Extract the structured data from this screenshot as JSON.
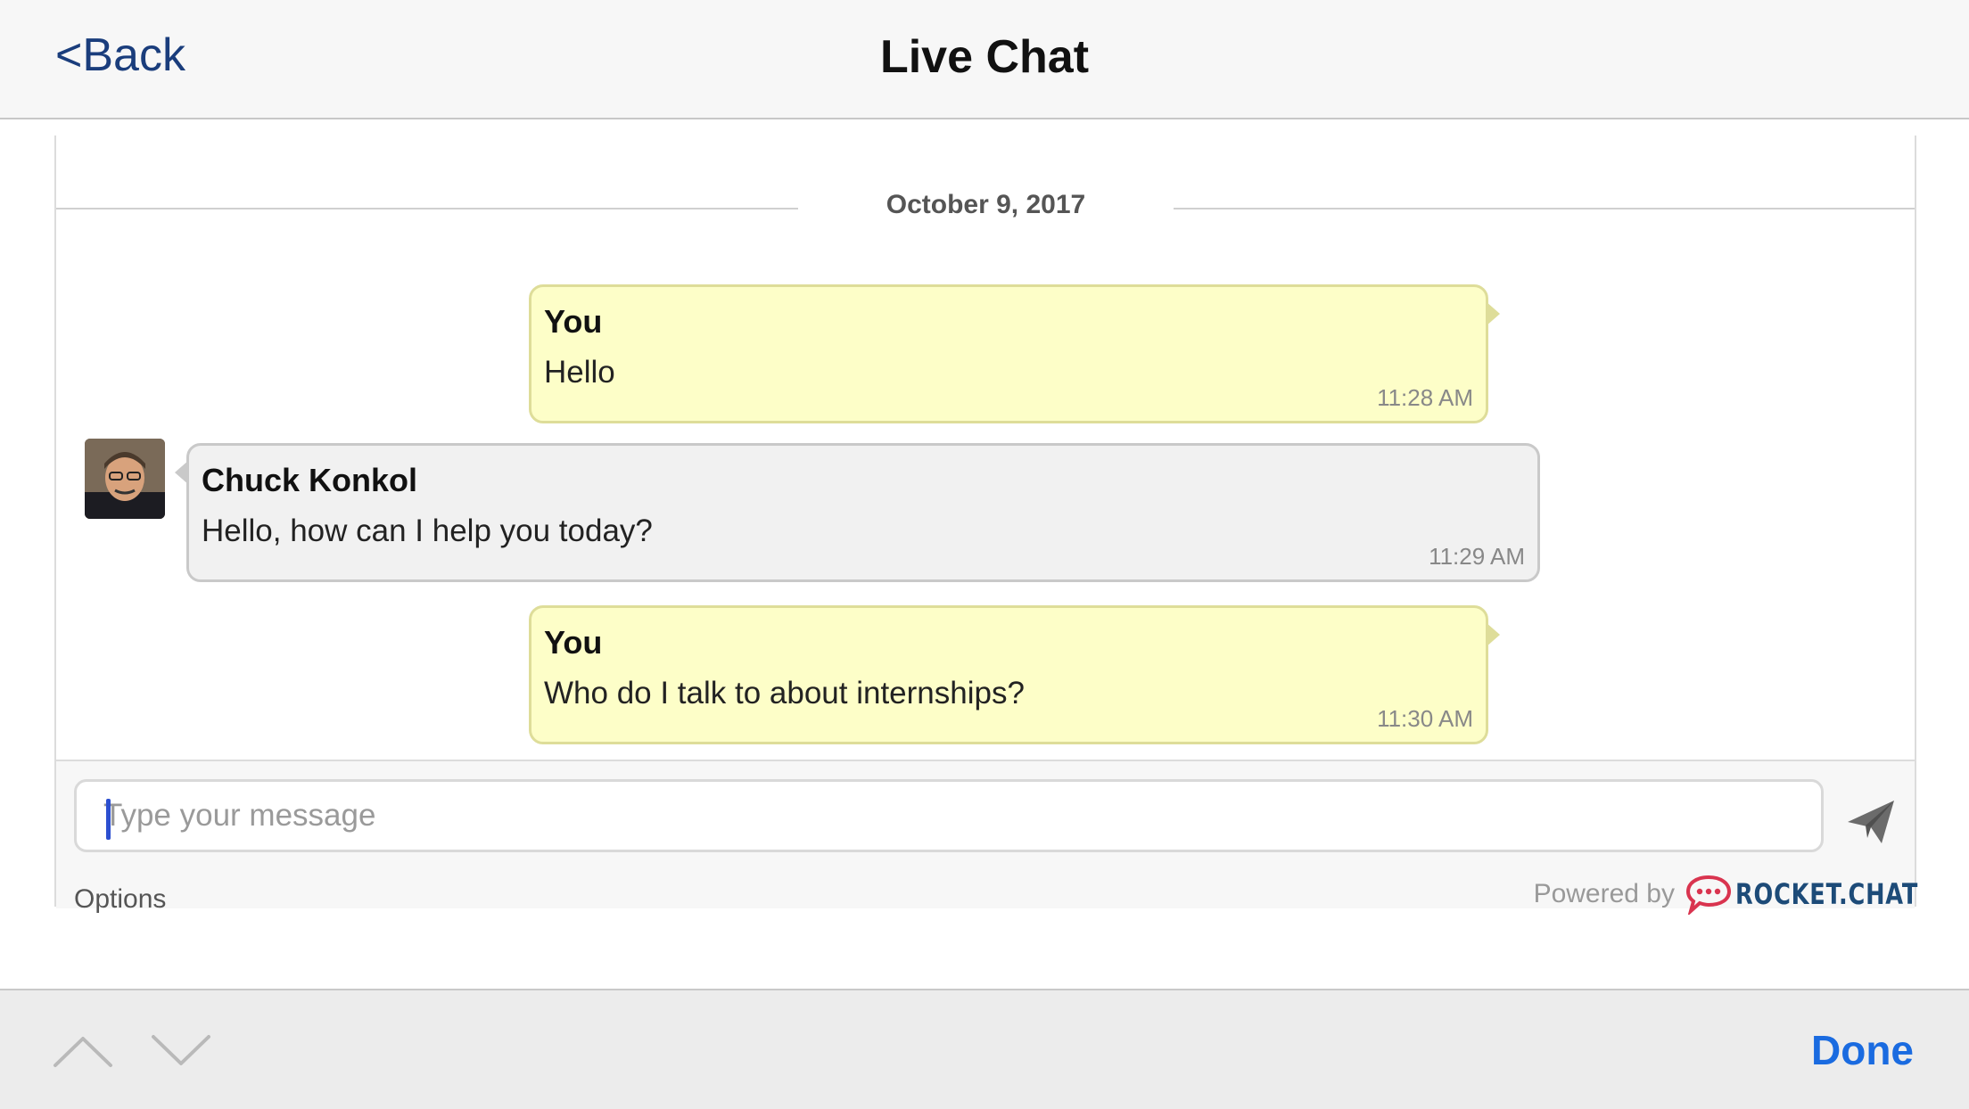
{
  "navbar": {
    "back_label": "<Back",
    "title": "Live Chat"
  },
  "chat": {
    "date": "October 9, 2017",
    "messages": [
      {
        "author": "You",
        "text": "Hello",
        "time": "11:28 AM"
      },
      {
        "author": "Chuck Konkol",
        "text": "Hello, how can I help you today?",
        "time": "11:29 AM"
      },
      {
        "author": "You",
        "text": "Who do I talk to about internships?",
        "time": "11:30 AM"
      }
    ]
  },
  "composer": {
    "placeholder": "Type your message",
    "options_label": "Options",
    "powered_by": "Powered by",
    "brand": "ROCKET.CHAT",
    "brand_icon": "rocket-chat-logo-icon",
    "send_icon": "paper-plane-icon"
  },
  "keyboard_toolbar": {
    "prev_icon": "chevron-up-icon",
    "next_icon": "chevron-down-icon",
    "done_label": "Done"
  },
  "colors": {
    "own_bubble": "#fdfec8",
    "other_bubble": "#f1f1f1",
    "link_blue": "#1a6be0",
    "back_blue": "#1a3d7c",
    "brand_red": "#d9344f",
    "brand_blue": "#1d4b78"
  }
}
